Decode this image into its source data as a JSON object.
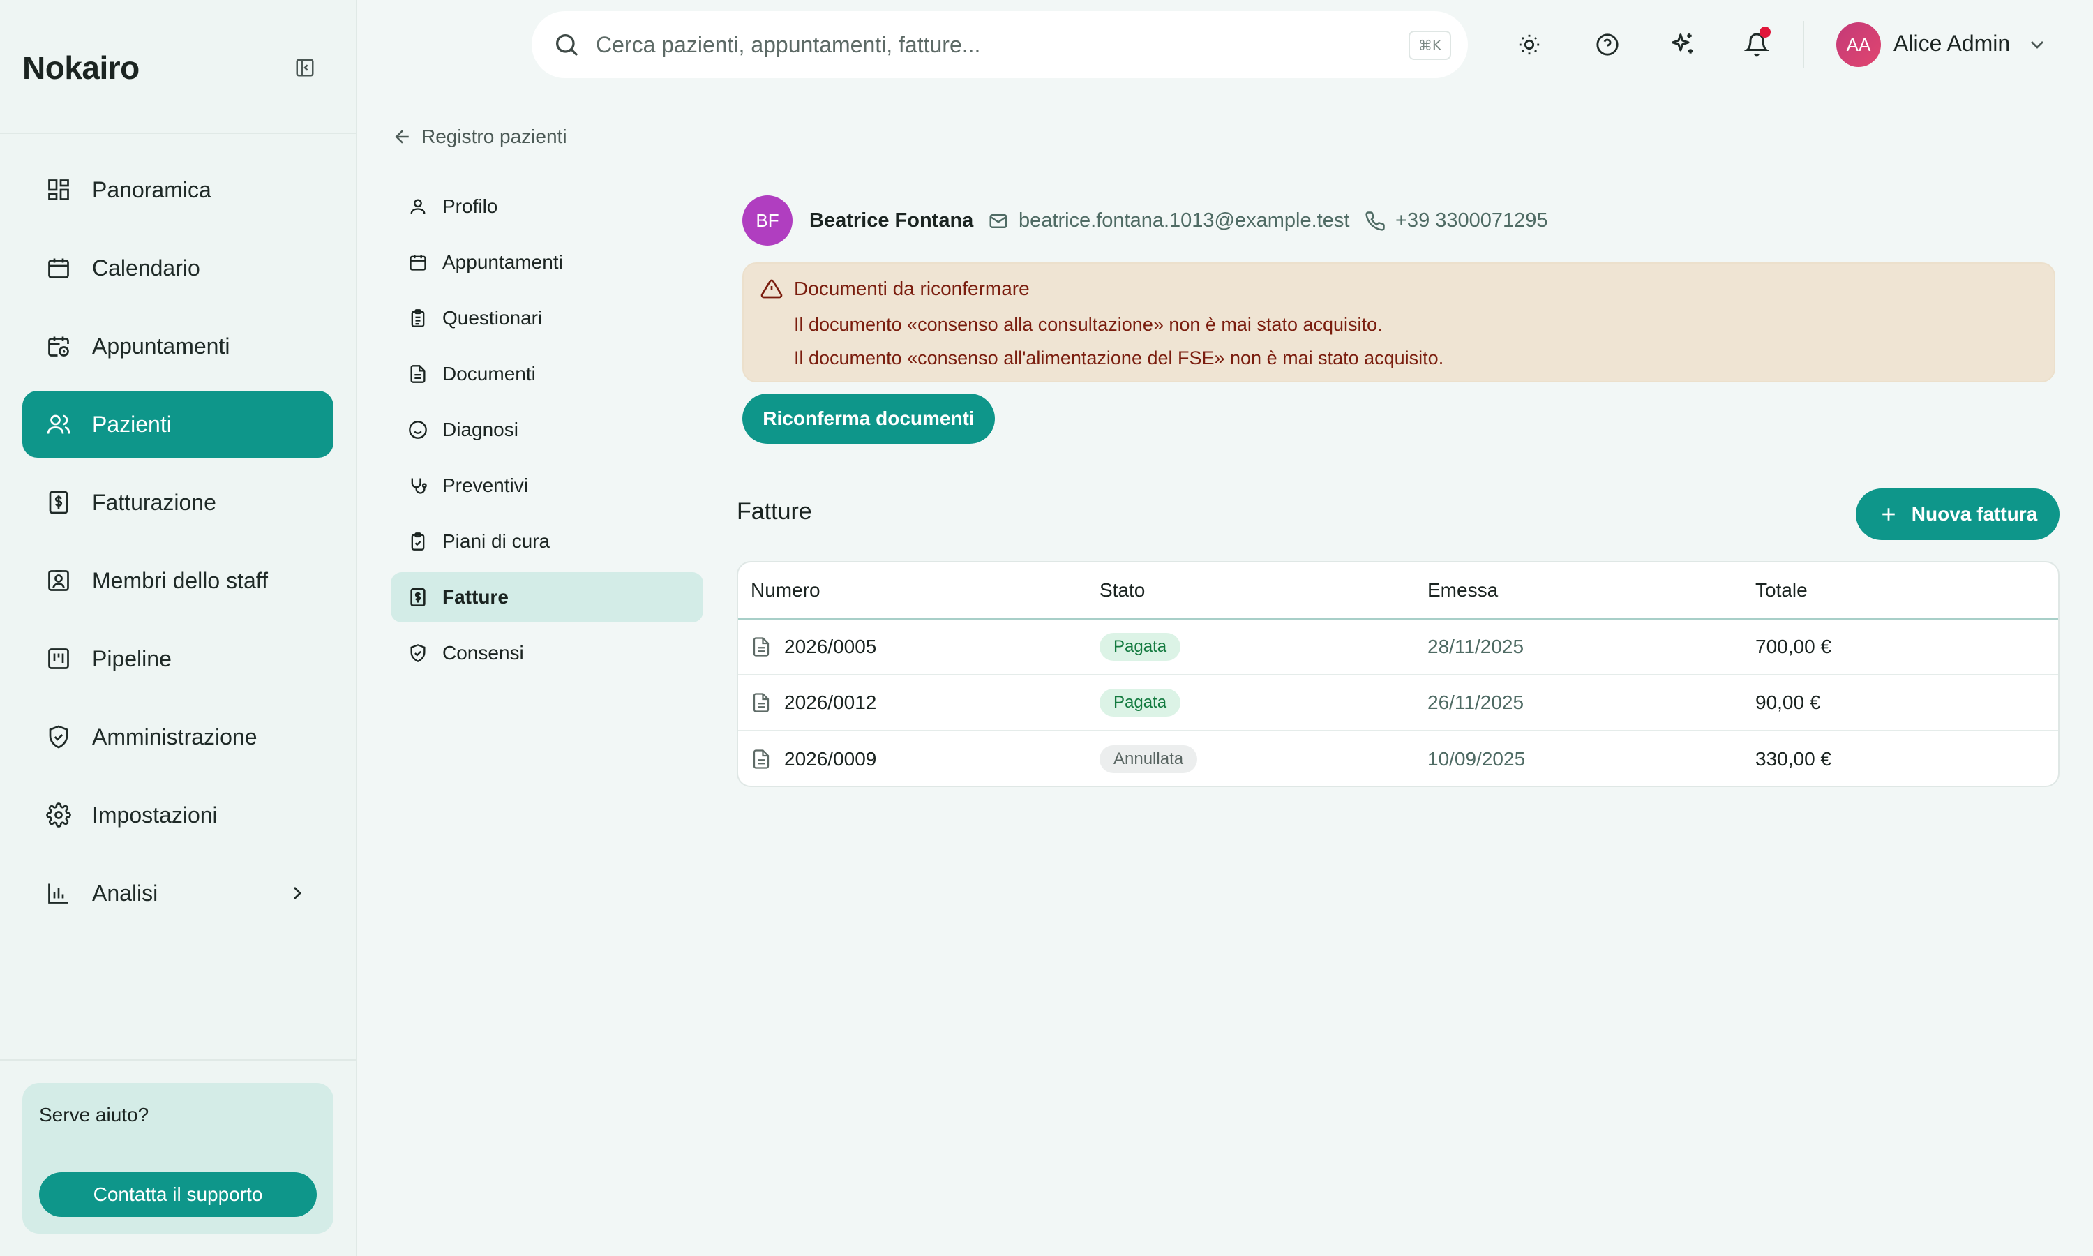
{
  "app": {
    "brand": "Nokairo"
  },
  "sidebar": {
    "items": [
      {
        "label": "Panoramica",
        "icon": "dashboard-icon"
      },
      {
        "label": "Calendario",
        "icon": "calendar-icon"
      },
      {
        "label": "Appuntamenti",
        "icon": "calendar-clock-icon"
      },
      {
        "label": "Pazienti",
        "icon": "users-icon",
        "active": true
      },
      {
        "label": "Fatturazione",
        "icon": "receipt-icon"
      },
      {
        "label": "Membri dello staff",
        "icon": "id-badge-icon"
      },
      {
        "label": "Pipeline",
        "icon": "kanban-icon"
      },
      {
        "label": "Amministrazione",
        "icon": "shield-check-icon"
      },
      {
        "label": "Impostazioni",
        "icon": "gear-icon"
      },
      {
        "label": "Analisi",
        "icon": "bar-chart-icon"
      }
    ],
    "help": {
      "title": "Serve aiuto?",
      "button": "Contatta il supporto"
    }
  },
  "topbar": {
    "search_placeholder": "Cerca pazienti, appuntamenti, fatture...",
    "shortcut": "⌘K",
    "user": {
      "initials": "AA",
      "name": "Alice Admin"
    }
  },
  "subnav": {
    "back": "Registro pazienti",
    "items": [
      {
        "label": "Profilo"
      },
      {
        "label": "Appuntamenti"
      },
      {
        "label": "Questionari"
      },
      {
        "label": "Documenti"
      },
      {
        "label": "Diagnosi"
      },
      {
        "label": "Preventivi"
      },
      {
        "label": "Piani di cura"
      },
      {
        "label": "Fatture",
        "active": true
      },
      {
        "label": "Consensi"
      }
    ]
  },
  "patient": {
    "initials": "BF",
    "name": "Beatrice Fontana",
    "email": "beatrice.fontana.1013@example.test",
    "phone": "+39 3300071295"
  },
  "alert": {
    "title": "Documenti da riconfermare",
    "line1": "Il documento «consenso alla consultazione» non è mai stato acquisito.",
    "line2": "Il documento «consenso all'alimentazione del FSE» non è mai stato acquisito.",
    "button": "Riconferma documenti"
  },
  "invoices": {
    "title": "Fatture",
    "new_button": "Nuova fattura",
    "headers": [
      "Numero",
      "Stato",
      "Emessa",
      "Totale"
    ],
    "rows": [
      {
        "number": "2026/0005",
        "status": "Pagata",
        "issued": "28/11/2025",
        "total": "700,00 €"
      },
      {
        "number": "2026/0012",
        "status": "Pagata",
        "issued": "26/11/2025",
        "total": "90,00 €"
      },
      {
        "number": "2026/0009",
        "status": "Annullata",
        "issued": "10/09/2025",
        "total": "330,00 €"
      }
    ]
  },
  "colors": {
    "accent": "#0e968a",
    "alert_bg": "#efe4d3",
    "alert_text": "#7a1d0e",
    "notification": "#e0173a"
  }
}
